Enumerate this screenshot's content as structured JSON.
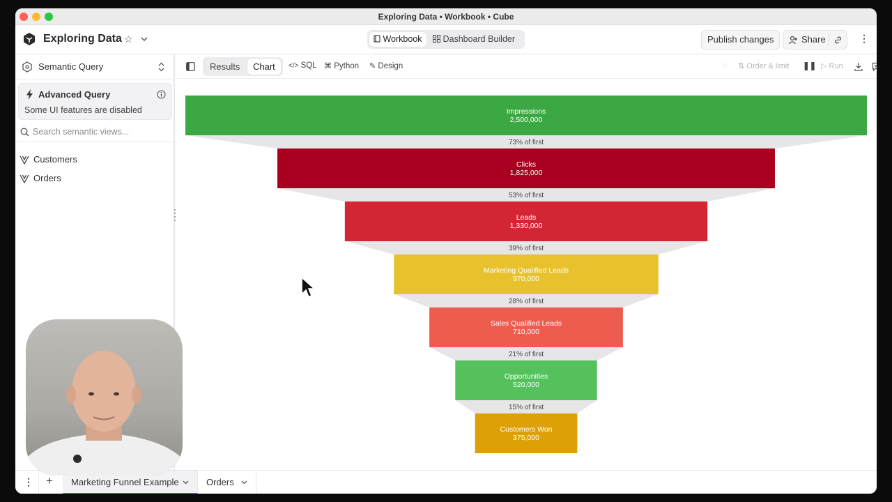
{
  "window": {
    "title": "Exploring Data • Workbook • Cube"
  },
  "header": {
    "workbook_name": "Exploring Data",
    "modes": [
      {
        "label": "Workbook"
      },
      {
        "label": "Dashboard Builder"
      }
    ],
    "publish_label": "Publish changes",
    "share_label": "Share"
  },
  "sidebar": {
    "query_mode": "Semantic Query",
    "advanced": {
      "title": "Advanced Query",
      "subtitle": "Some UI features are disabled"
    },
    "search_placeholder": "Search semantic views...",
    "items": [
      {
        "label": "Customers"
      },
      {
        "label": "Orders"
      }
    ]
  },
  "toolbar": {
    "tabs": [
      {
        "label": "Results"
      },
      {
        "label": "Chart"
      }
    ],
    "sql_label": "SQL",
    "python_label": "Python",
    "design_label": "Design",
    "order_limit_label": "Order & limit",
    "run_label": "Run"
  },
  "bottom_tabs": [
    {
      "label": "Marketing Funnel Example"
    },
    {
      "label": "Orders"
    }
  ],
  "chart_data": {
    "type": "funnel",
    "stages": [
      {
        "label": "Impressions",
        "value": 2500000,
        "value_label": "2,500,000",
        "color": "#3ba843"
      },
      {
        "label": "Clicks",
        "value": 1825000,
        "value_label": "1,825,000",
        "color": "#a8001e"
      },
      {
        "label": "Leads",
        "value": 1330000,
        "value_label": "1,330,000",
        "color": "#d32534"
      },
      {
        "label": "Marketing Qualified Leads",
        "value": 970000,
        "value_label": "970,000",
        "color": "#e8c22d"
      },
      {
        "label": "Sales Qualified Leads",
        "value": 710000,
        "value_label": "710,000",
        "color": "#ee5b4f"
      },
      {
        "label": "Opportunities",
        "value": 520000,
        "value_label": "520,000",
        "color": "#54c15c"
      },
      {
        "label": "Customers Won",
        "value": 375000,
        "value_label": "375,000",
        "color": "#dea007"
      }
    ],
    "conversions": [
      "73% of first",
      "53% of first",
      "39% of first",
      "28% of first",
      "21% of first",
      "15% of first"
    ],
    "connector_color": "#e6e6e8"
  }
}
